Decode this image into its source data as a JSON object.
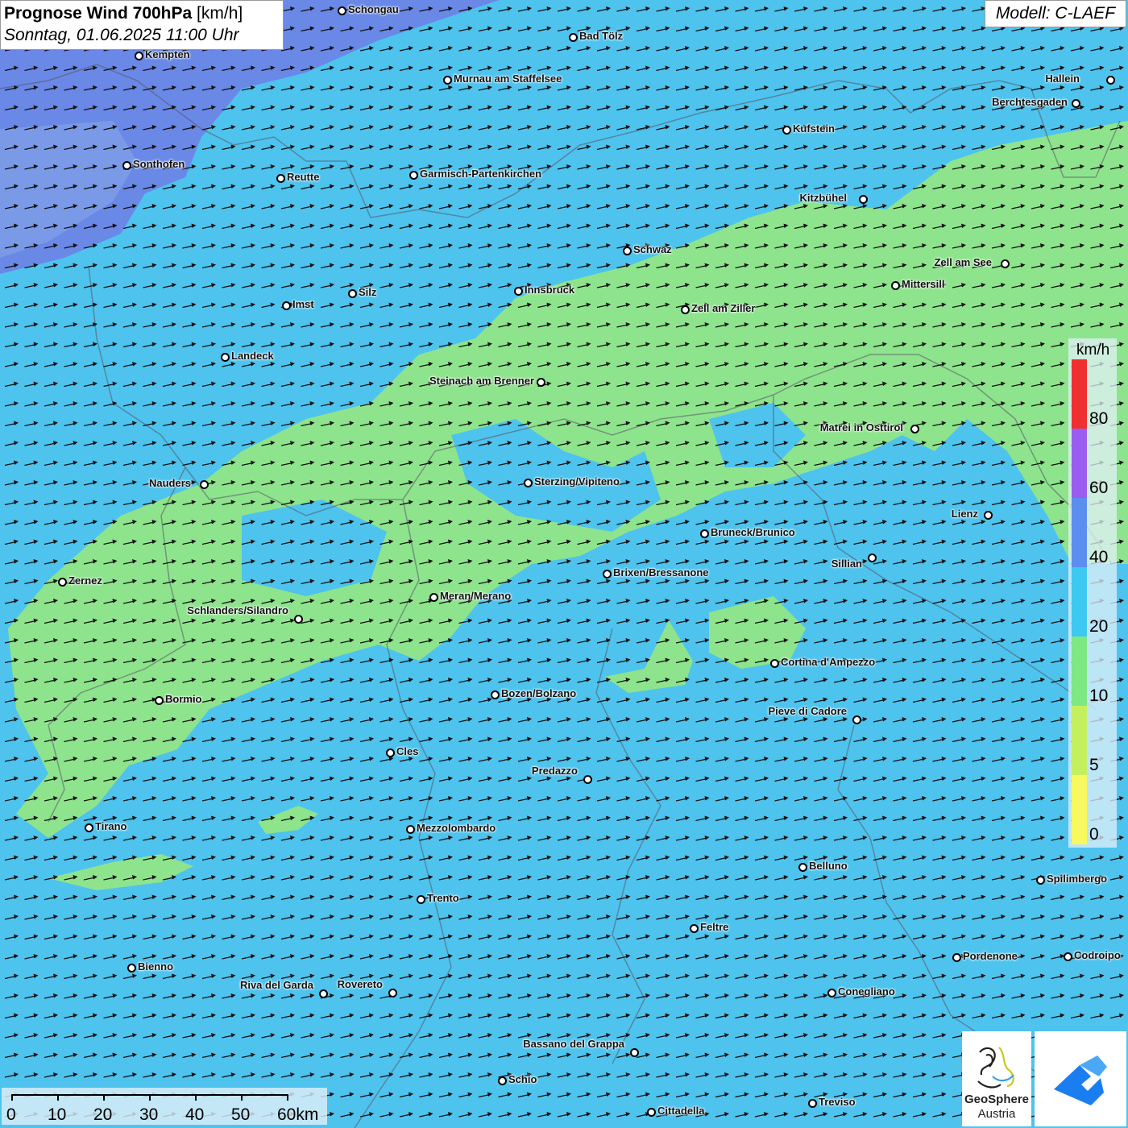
{
  "title": {
    "bold": "Prognose Wind 700hPa",
    "unit": "[km/h]",
    "date": "Sonntag, 01.06.2025 11:00 Uhr"
  },
  "model": "Modell: C-LAEF",
  "cities": [
    {
      "name": "Schongau"
    },
    {
      "name": "Bad Tölz"
    },
    {
      "name": "Kempten"
    },
    {
      "name": "Murnau am Staffelsee"
    },
    {
      "name": "Hallein"
    },
    {
      "name": "Berchtesgaden"
    },
    {
      "name": "Kufstein"
    },
    {
      "name": "Sonthofen"
    },
    {
      "name": "Reutte"
    },
    {
      "name": "Garmisch-Partenkirchen"
    },
    {
      "name": "Kitzbühel"
    },
    {
      "name": "Schwaz"
    },
    {
      "name": "Zell am See"
    },
    {
      "name": "Mittersill"
    },
    {
      "name": "Innsbruck"
    },
    {
      "name": "Silz"
    },
    {
      "name": "Imst"
    },
    {
      "name": "Zell am Ziller"
    },
    {
      "name": "Landeck"
    },
    {
      "name": "Steinach am Brenner"
    },
    {
      "name": "Matrei in Osttirol"
    },
    {
      "name": "Nauders"
    },
    {
      "name": "Sterzing/Vipiteno"
    },
    {
      "name": "Lienz"
    },
    {
      "name": "Bruneck/Brunico"
    },
    {
      "name": "Sillian"
    },
    {
      "name": "Zernez"
    },
    {
      "name": "Brixen/Bressanone"
    },
    {
      "name": "Meran/Merano"
    },
    {
      "name": "Schlanders/Silandro"
    },
    {
      "name": "Cortina d'Ampezzo"
    },
    {
      "name": "Bozen/Bolzano"
    },
    {
      "name": "Bormio"
    },
    {
      "name": "Pieve di Cadore"
    },
    {
      "name": "Cles"
    },
    {
      "name": "Predazzo"
    },
    {
      "name": "Tirano"
    },
    {
      "name": "Mezzolombardo"
    },
    {
      "name": "Belluno"
    },
    {
      "name": "Spilimbergo"
    },
    {
      "name": "Trento"
    },
    {
      "name": "Feltre"
    },
    {
      "name": "Bienno"
    },
    {
      "name": "Pordenone"
    },
    {
      "name": "Codroipo"
    },
    {
      "name": "Riva del Garda"
    },
    {
      "name": "Rovereto"
    },
    {
      "name": "Conegliano"
    },
    {
      "name": "Bassano del Grappa"
    },
    {
      "name": "Schio"
    },
    {
      "name": "Treviso"
    },
    {
      "name": "Cittadella"
    }
  ],
  "legend": {
    "unit": "km/h",
    "labels": [
      "80",
      "60",
      "40",
      "20",
      "10",
      "5",
      "0"
    ],
    "colors": [
      "#f03030",
      "#9b5cf0",
      "#5c8ef0",
      "#3cc8f0",
      "#7ee882",
      "#c4f060",
      "#f8f860"
    ]
  },
  "scale": {
    "labels": [
      "0",
      "10",
      "20",
      "30",
      "40",
      "50",
      "60km"
    ]
  },
  "logos": {
    "geosphere_line1": "GeoSphere",
    "geosphere_line2": "Austria"
  },
  "wind": {
    "direction": "from west-southwest",
    "field_colors": {
      "strong": "#6a86e8",
      "medium": "#4ec3ee",
      "light": "#8ee48c"
    }
  }
}
